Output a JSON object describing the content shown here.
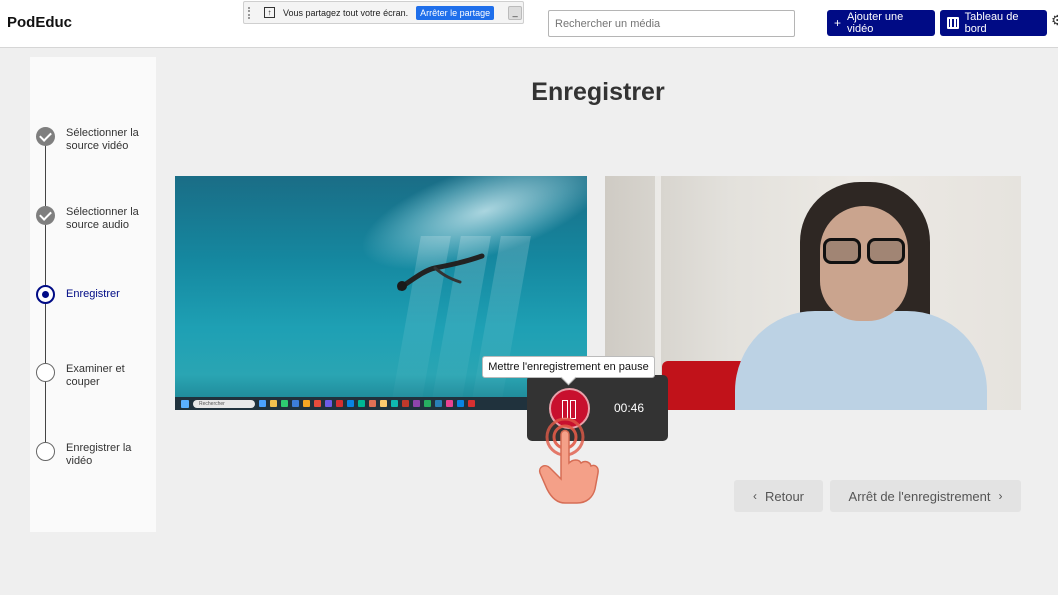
{
  "header": {
    "brand": "PodEduc",
    "share_bar": {
      "message": "Vous partagez tout votre écran.",
      "stop_label": "Arrêter le partage",
      "minimize_label": "_"
    },
    "search": {
      "placeholder": "Rechercher un média"
    },
    "add_video_label": "Ajouter une vidéo",
    "dashboard_label": "Tableau de bord"
  },
  "stepper": {
    "steps": [
      {
        "label": "Sélectionner la source vidéo",
        "state": "done"
      },
      {
        "label": "Sélectionner la source audio",
        "state": "done"
      },
      {
        "label": "Enregistrer",
        "state": "current"
      },
      {
        "label": "Examiner et couper",
        "state": "todo"
      },
      {
        "label": "Enregistrer la vidéo",
        "state": "todo"
      }
    ]
  },
  "main": {
    "title": "Enregistrer",
    "screen_taskbar_search": "Rechercher"
  },
  "recording": {
    "tooltip": "Mettre l'enregistrement en pause",
    "timer": "00:46"
  },
  "footer": {
    "back_label": "Retour",
    "stop_label": "Arrêt de l'enregistrement"
  },
  "colors": {
    "primary": "#000b85",
    "record_red": "#c8102e",
    "overlay_dark": "#333333"
  }
}
